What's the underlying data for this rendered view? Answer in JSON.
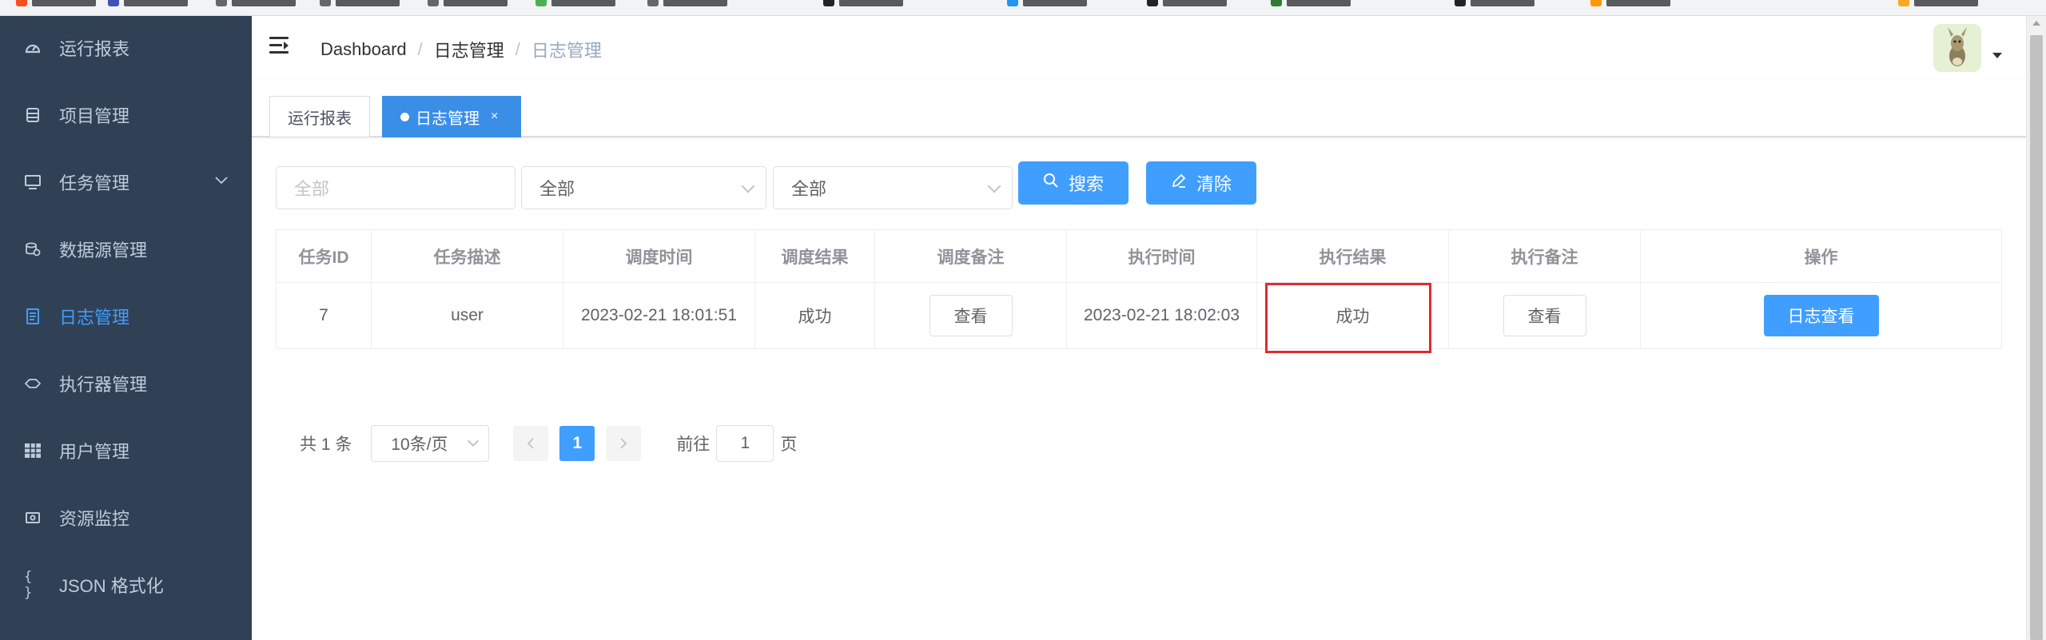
{
  "sidebar": {
    "items": [
      {
        "label": "运行报表",
        "icon": "dashboard-icon"
      },
      {
        "label": "项目管理",
        "icon": "database-icon"
      },
      {
        "label": "任务管理",
        "icon": "monitor-icon"
      },
      {
        "label": "数据源管理",
        "icon": "datasource-icon"
      },
      {
        "label": "日志管理",
        "icon": "document-icon"
      },
      {
        "label": "执行器管理",
        "icon": "executor-icon"
      },
      {
        "label": "用户管理",
        "icon": "grid-icon"
      },
      {
        "label": "资源监控",
        "icon": "money-icon"
      },
      {
        "label": "JSON 格式化",
        "icon": "braces-icon"
      }
    ],
    "active_index": 4,
    "active_color": "#409eff"
  },
  "header": {
    "breadcrumb": [
      "Dashboard",
      "日志管理",
      "日志管理"
    ],
    "separator": "/"
  },
  "tags": {
    "items": [
      {
        "label": "运行报表",
        "active": false
      },
      {
        "label": "日志管理",
        "active": true,
        "close": "×"
      }
    ]
  },
  "filters": {
    "input_placeholder": "全部",
    "select1_value": "全部",
    "select2_value": "全部",
    "search_label": "搜索",
    "clear_label": "清除"
  },
  "table": {
    "columns": [
      "任务ID",
      "任务描述",
      "调度时间",
      "调度结果",
      "调度备注",
      "执行时间",
      "执行结果",
      "执行备注",
      "操作"
    ],
    "rows": [
      {
        "task_id": "7",
        "desc": "user",
        "trigger_time": "2023-02-21 18:01:51",
        "trigger_result": "成功",
        "trigger_note_btn": "查看",
        "handle_time": "2023-02-21 18:02:03",
        "handle_result": "成功",
        "handle_note_btn": "查看",
        "action_btn": "日志查看"
      }
    ]
  },
  "pagination": {
    "total": "共 1 条",
    "page_size": "10条/页",
    "current_page": "1",
    "goto_label": "前往",
    "goto_value": "1",
    "page_unit": "页"
  },
  "colors": {
    "primary": "#409eff",
    "sidebar_bg": "#304156",
    "highlight": "#e02b2b"
  }
}
